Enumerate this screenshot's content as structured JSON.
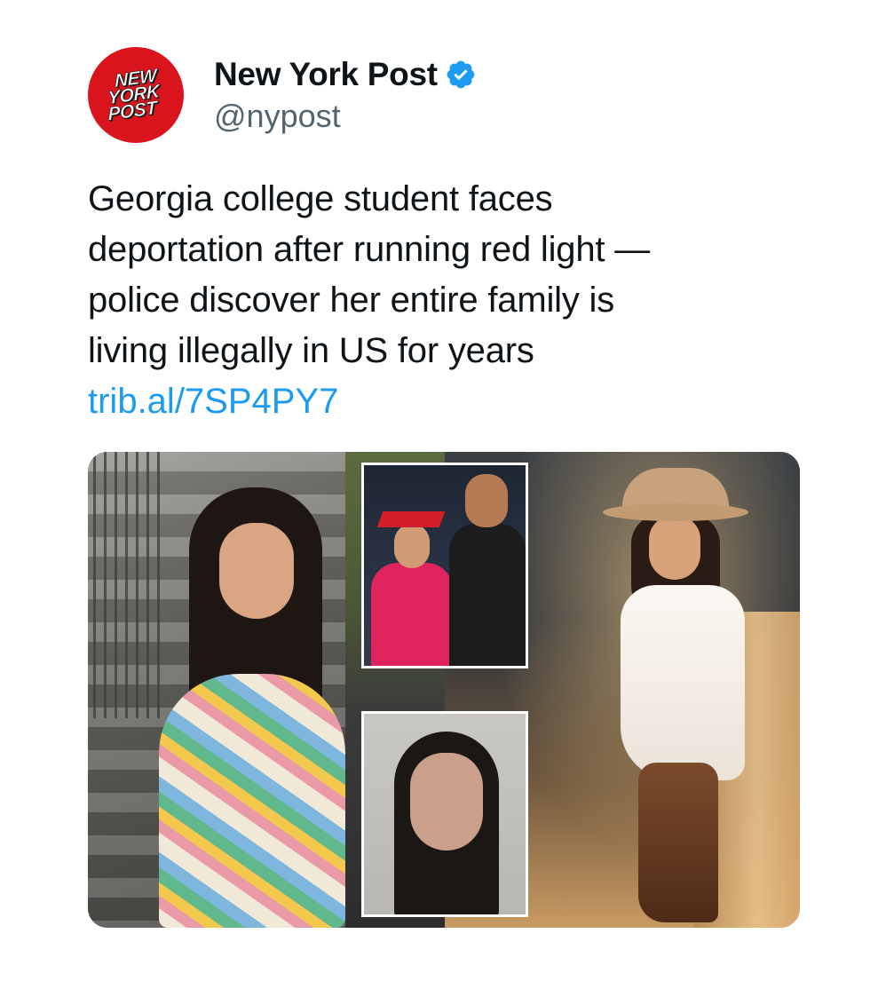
{
  "author": {
    "display_name": "New York Post",
    "handle": "@nypost",
    "avatar_logo_lines": [
      "NEW",
      "YORK",
      "POST"
    ],
    "verified_icon": "verified-badge-icon",
    "avatar_color": "#d9141d",
    "verified_color": "#1d9bf0"
  },
  "tweet": {
    "text_lines": [
      "Georgia college student faces",
      "deportation after running red light —",
      "police discover her entire family is",
      "living illegally in US for years"
    ],
    "link": "trib.al/7SP4PY7",
    "link_color": "#1d9bf0"
  },
  "media": {
    "photos": [
      "photo-student-on-steps",
      "photo-graduation-with-father",
      "photo-mugshot",
      "photo-cowboy-hat-white-dress"
    ]
  }
}
